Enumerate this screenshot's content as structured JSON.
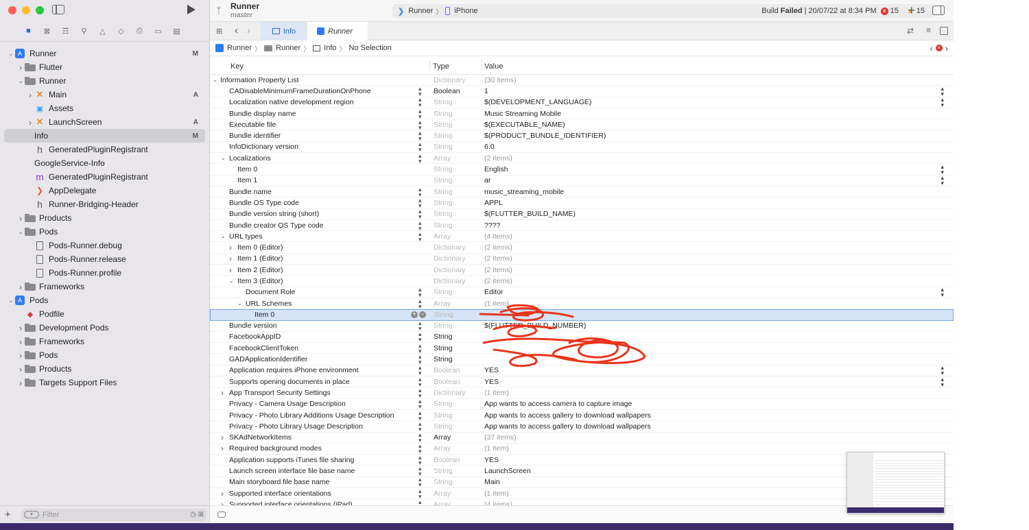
{
  "sidebar": {
    "tree": [
      {
        "label": "Runner",
        "icon": "xcode-project-icon",
        "level": 0,
        "expanded": true,
        "badge": "M"
      },
      {
        "label": "Flutter",
        "icon": "folder-icon",
        "level": 1,
        "expanded": false,
        "badge": ""
      },
      {
        "label": "Runner",
        "icon": "folder-icon",
        "level": 1,
        "expanded": true,
        "badge": ""
      },
      {
        "label": "Main",
        "icon": "storyboard-icon",
        "level": 2,
        "expanded": false,
        "badge": "A"
      },
      {
        "label": "Assets",
        "icon": "assets-icon",
        "level": 2,
        "expanded": null,
        "badge": ""
      },
      {
        "label": "LaunchScreen",
        "icon": "storyboard-icon",
        "level": 2,
        "expanded": false,
        "badge": "A"
      },
      {
        "label": "Info",
        "icon": "plist-icon",
        "level": 2,
        "expanded": null,
        "badge": "M",
        "selected": true
      },
      {
        "label": "GeneratedPluginRegistrant",
        "icon": "header-file-icon",
        "level": 2,
        "expanded": null,
        "badge": ""
      },
      {
        "label": "GoogleService-Info",
        "icon": "plist-icon",
        "level": 2,
        "expanded": null,
        "badge": ""
      },
      {
        "label": "GeneratedPluginRegistrant",
        "icon": "objc-file-icon",
        "level": 2,
        "expanded": null,
        "badge": ""
      },
      {
        "label": "AppDelegate",
        "icon": "swift-file-icon",
        "level": 2,
        "expanded": null,
        "badge": ""
      },
      {
        "label": "Runner-Bridging-Header",
        "icon": "header-file-icon",
        "level": 2,
        "expanded": null,
        "badge": ""
      },
      {
        "label": "Products",
        "icon": "folder-icon",
        "level": 1,
        "expanded": false,
        "badge": ""
      },
      {
        "label": "Pods",
        "icon": "folder-icon",
        "level": 1,
        "expanded": true,
        "badge": ""
      },
      {
        "label": "Pods-Runner.debug",
        "icon": "document-icon",
        "level": 2,
        "expanded": null,
        "badge": ""
      },
      {
        "label": "Pods-Runner.release",
        "icon": "document-icon",
        "level": 2,
        "expanded": null,
        "badge": ""
      },
      {
        "label": "Pods-Runner.profile",
        "icon": "document-icon",
        "level": 2,
        "expanded": null,
        "badge": ""
      },
      {
        "label": "Frameworks",
        "icon": "folder-icon",
        "level": 1,
        "expanded": false,
        "badge": ""
      },
      {
        "label": "Pods",
        "icon": "xcode-project-icon",
        "level": 0,
        "expanded": true,
        "badge": ""
      },
      {
        "label": "Podfile",
        "icon": "ruby-file-icon",
        "level": 1,
        "expanded": null,
        "badge": ""
      },
      {
        "label": "Development Pods",
        "icon": "folder-icon",
        "level": 1,
        "expanded": false,
        "badge": ""
      },
      {
        "label": "Frameworks",
        "icon": "folder-icon",
        "level": 1,
        "expanded": false,
        "badge": ""
      },
      {
        "label": "Pods",
        "icon": "folder-icon",
        "level": 1,
        "expanded": false,
        "badge": ""
      },
      {
        "label": "Products",
        "icon": "folder-icon",
        "level": 1,
        "expanded": false,
        "badge": ""
      },
      {
        "label": "Targets Support Files",
        "icon": "folder-icon",
        "level": 1,
        "expanded": false,
        "badge": ""
      }
    ],
    "filter_placeholder": "Filter"
  },
  "toolbar": {
    "project": "Runner",
    "branch": "master",
    "scheme": "Runner",
    "device": "iPhone",
    "status_prefix": "Build ",
    "status_bold": "Failed",
    "status_suffix": " | 20/07/22 at 8:34 PM",
    "error_count": "15",
    "warning_count": "15"
  },
  "tabs": [
    {
      "label": "Info",
      "active": true
    },
    {
      "label": "Runner",
      "active": false
    }
  ],
  "jumpbar": [
    "Runner",
    "Runner",
    "Info",
    "No Selection"
  ],
  "plist": {
    "columns": [
      "Key",
      "Type",
      "Value"
    ],
    "rows": [
      {
        "indent": 0,
        "tri": "open",
        "key": "Information Property List",
        "type": "Dictionary",
        "value": "(30 items)",
        "tdark": false,
        "vgray": true,
        "stp": false,
        "vstp": false
      },
      {
        "indent": 1,
        "tri": "",
        "key": "CADisableMinimumFrameDurationOnPhone",
        "type": "Boolean",
        "value": "1",
        "tdark": true,
        "vgray": false,
        "stp": true,
        "vstp": true
      },
      {
        "indent": 1,
        "tri": "",
        "key": "Localization native development region",
        "type": "String",
        "value": "$(DEVELOPMENT_LANGUAGE)",
        "tdark": false,
        "vgray": false,
        "stp": true,
        "vstp": true
      },
      {
        "indent": 1,
        "tri": "",
        "key": "Bundle display name",
        "type": "String",
        "value": "Music Streaming Mobile",
        "tdark": false,
        "vgray": false,
        "stp": true,
        "vstp": false
      },
      {
        "indent": 1,
        "tri": "",
        "key": "Executable file",
        "type": "String",
        "value": "$(EXECUTABLE_NAME)",
        "tdark": false,
        "vgray": false,
        "stp": true,
        "vstp": false
      },
      {
        "indent": 1,
        "tri": "",
        "key": "Bundle identifier",
        "type": "String",
        "value": "$(PRODUCT_BUNDLE_IDENTIFIER)",
        "tdark": false,
        "vgray": false,
        "stp": true,
        "vstp": false
      },
      {
        "indent": 1,
        "tri": "",
        "key": "InfoDictionary version",
        "type": "String",
        "value": "6.0",
        "tdark": false,
        "vgray": false,
        "stp": true,
        "vstp": false
      },
      {
        "indent": 1,
        "tri": "open",
        "key": "Localizations",
        "type": "Array",
        "value": "(2 items)",
        "tdark": false,
        "vgray": true,
        "stp": true,
        "vstp": false
      },
      {
        "indent": 2,
        "tri": "",
        "key": "Item 0",
        "type": "String",
        "value": "English",
        "tdark": false,
        "vgray": false,
        "stp": false,
        "vstp": true
      },
      {
        "indent": 2,
        "tri": "",
        "key": "Item 1",
        "type": "String",
        "value": "ar",
        "tdark": false,
        "vgray": false,
        "stp": false,
        "vstp": true
      },
      {
        "indent": 1,
        "tri": "",
        "key": "Bundle name",
        "type": "String",
        "value": "music_streaming_mobile",
        "tdark": false,
        "vgray": false,
        "stp": true,
        "vstp": false
      },
      {
        "indent": 1,
        "tri": "",
        "key": "Bundle OS Type code",
        "type": "String",
        "value": "APPL",
        "tdark": false,
        "vgray": false,
        "stp": true,
        "vstp": false
      },
      {
        "indent": 1,
        "tri": "",
        "key": "Bundle version string (short)",
        "type": "String",
        "value": "$(FLUTTER_BUILD_NAME)",
        "tdark": false,
        "vgray": false,
        "stp": true,
        "vstp": false
      },
      {
        "indent": 1,
        "tri": "",
        "key": "Bundle creator OS Type code",
        "type": "String",
        "value": "????",
        "tdark": false,
        "vgray": false,
        "stp": true,
        "vstp": false
      },
      {
        "indent": 1,
        "tri": "open",
        "key": "URL types",
        "type": "Array",
        "value": "(4 items)",
        "tdark": false,
        "vgray": true,
        "stp": true,
        "vstp": false
      },
      {
        "indent": 2,
        "tri": "closed",
        "key": "Item 0 (Editor)",
        "type": "Dictionary",
        "value": "(2 items)",
        "tdark": false,
        "vgray": true,
        "stp": false,
        "vstp": false
      },
      {
        "indent": 2,
        "tri": "closed",
        "key": "Item 1 (Editor)",
        "type": "Dictionary",
        "value": "(2 items)",
        "tdark": false,
        "vgray": true,
        "stp": false,
        "vstp": false
      },
      {
        "indent": 2,
        "tri": "closed",
        "key": "Item 2 (Editor)",
        "type": "Dictionary",
        "value": "(2 items)",
        "tdark": false,
        "vgray": true,
        "stp": false,
        "vstp": false
      },
      {
        "indent": 2,
        "tri": "open",
        "key": "Item 3 (Editor)",
        "type": "Dictionary",
        "value": "(2 items)",
        "tdark": false,
        "vgray": true,
        "stp": false,
        "vstp": false
      },
      {
        "indent": 3,
        "tri": "",
        "key": "Document Role",
        "type": "String",
        "value": "Editor",
        "tdark": false,
        "vgray": false,
        "stp": true,
        "vstp": true
      },
      {
        "indent": 3,
        "tri": "open",
        "key": "URL Schemes",
        "type": "Array",
        "value": "(1 item)",
        "tdark": false,
        "vgray": true,
        "stp": true,
        "vstp": false
      },
      {
        "indent": 4,
        "tri": "",
        "key": "Item 0",
        "type": "String",
        "value": "",
        "tdark": false,
        "vgray": false,
        "stp": false,
        "vstp": false,
        "selected": true
      },
      {
        "indent": 1,
        "tri": "",
        "key": "Bundle version",
        "type": "String",
        "value": "$(FLUTTER_BUILD_NUMBER)",
        "tdark": false,
        "vgray": false,
        "stp": true,
        "vstp": false
      },
      {
        "indent": 1,
        "tri": "",
        "key": "FacebookAppID",
        "type": "String",
        "value": "",
        "tdark": true,
        "vgray": false,
        "stp": true,
        "vstp": false
      },
      {
        "indent": 1,
        "tri": "",
        "key": "FacebookClientToken",
        "type": "String",
        "value": "",
        "tdark": true,
        "vgray": false,
        "stp": true,
        "vstp": false
      },
      {
        "indent": 1,
        "tri": "",
        "key": "GADApplicationIdentifier",
        "type": "String",
        "value": "",
        "tdark": true,
        "vgray": false,
        "stp": true,
        "vstp": false
      },
      {
        "indent": 1,
        "tri": "",
        "key": "Application requires iPhone environment",
        "type": "Boolean",
        "value": "YES",
        "tdark": false,
        "vgray": false,
        "stp": true,
        "vstp": true
      },
      {
        "indent": 1,
        "tri": "",
        "key": "Supports opening documents in place",
        "type": "Boolean",
        "value": "YES",
        "tdark": false,
        "vgray": false,
        "stp": true,
        "vstp": true
      },
      {
        "indent": 1,
        "tri": "closed",
        "key": "App Transport Security Settings",
        "type": "Dictionary",
        "value": "(1 item)",
        "tdark": false,
        "vgray": true,
        "stp": true,
        "vstp": false
      },
      {
        "indent": 1,
        "tri": "",
        "key": "Privacy - Camera Usage Description",
        "type": "String",
        "value": "App wants to access camera to capture image",
        "tdark": false,
        "vgray": false,
        "stp": true,
        "vstp": false
      },
      {
        "indent": 1,
        "tri": "",
        "key": "Privacy - Photo Library Additions Usage Description",
        "type": "String",
        "value": "App wants to access gallery to download wallpapers",
        "tdark": false,
        "vgray": false,
        "stp": true,
        "vstp": false
      },
      {
        "indent": 1,
        "tri": "",
        "key": "Privacy - Photo Library Usage Description",
        "type": "String",
        "value": "App wants to access gallery to download wallpapers",
        "tdark": false,
        "vgray": false,
        "stp": true,
        "vstp": false
      },
      {
        "indent": 1,
        "tri": "closed",
        "key": "SKAdNetworkItems",
        "type": "Array",
        "value": "(37 items)",
        "tdark": true,
        "vgray": true,
        "stp": true,
        "vstp": false
      },
      {
        "indent": 1,
        "tri": "closed",
        "key": "Required background modes",
        "type": "Array",
        "value": "(1 item)",
        "tdark": false,
        "vgray": true,
        "stp": true,
        "vstp": false
      },
      {
        "indent": 1,
        "tri": "",
        "key": "Application supports iTunes file sharing",
        "type": "Boolean",
        "value": "YES",
        "tdark": false,
        "vgray": false,
        "stp": true,
        "vstp": false
      },
      {
        "indent": 1,
        "tri": "",
        "key": "Launch screen interface file base name",
        "type": "String",
        "value": "LaunchScreen",
        "tdark": false,
        "vgray": false,
        "stp": true,
        "vstp": false
      },
      {
        "indent": 1,
        "tri": "",
        "key": "Main storyboard file base name",
        "type": "String",
        "value": "Main",
        "tdark": false,
        "vgray": false,
        "stp": true,
        "vstp": false
      },
      {
        "indent": 1,
        "tri": "closed",
        "key": "Supported interface orientations",
        "type": "Array",
        "value": "(1 item)",
        "tdark": false,
        "vgray": true,
        "stp": true,
        "vstp": false
      },
      {
        "indent": 1,
        "tri": "closed",
        "key": "Supported interface orientations (iPad)",
        "type": "Array",
        "value": "(4 items)",
        "tdark": false,
        "vgray": true,
        "stp": true,
        "vstp": false
      }
    ]
  },
  "colors": {
    "accent": "#2f7bf6",
    "error": "#e0352f",
    "warning": "#f5a623",
    "redaction": "#e8341c"
  }
}
